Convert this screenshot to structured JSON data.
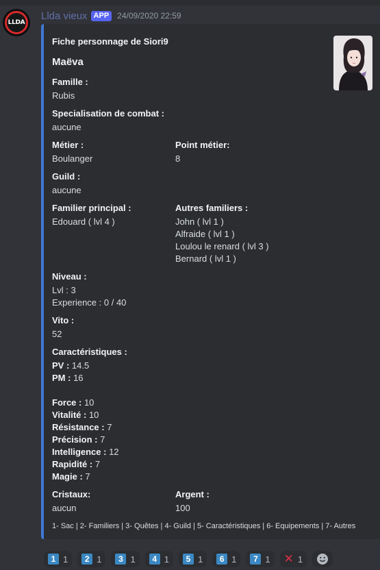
{
  "message": {
    "username": "Llda vieux",
    "badge": "APP",
    "timestamp": "24/09/2020 22:59",
    "avatar_text": "LLDA"
  },
  "embed": {
    "accent_color": "#3f79d6",
    "author": "Fiche personnage de Siori9",
    "title": "Maëva",
    "fields": {
      "famille_label": "Famille :",
      "famille_value": "Rubis",
      "specialisation_label": "Specialisation de combat :",
      "specialisation_value": "aucune",
      "metier_label": "Métier :",
      "metier_value": "Boulanger",
      "point_metier_label": "Point métier:",
      "point_metier_value": "8",
      "guild_label": "Guild :",
      "guild_value": "aucune",
      "familier_principal_label": "Familier principal :",
      "familier_principal_value": "Edouard ( lvl 4 )",
      "autres_familiers_label": "Autres familiers :",
      "autres_familiers": [
        "John ( lvl 1 )",
        "Alfraide ( lvl 1 )",
        "Loulou le renard ( lvl 3 )",
        "Bernard ( lvl 1 )"
      ],
      "niveau_label": "Niveau :",
      "niveau_lvl": "Lvl : 3",
      "niveau_xp": "Experience : 0 / 40",
      "vito_label": "Vito :",
      "vito_value": "52",
      "carac_label": "Caractéristiques :",
      "pv_label": "PV :",
      "pv_value": " 14.5",
      "pm_label": "PM :",
      "pm_value": " 16",
      "stats": [
        {
          "label": "Force :",
          "value": " 10"
        },
        {
          "label": "Vitalité :",
          "value": " 10"
        },
        {
          "label": "Résistance :",
          "value": " 7"
        },
        {
          "label": "Précision :",
          "value": " 7"
        },
        {
          "label": "Intelligence :",
          "value": " 12"
        },
        {
          "label": "Rapidité :",
          "value": " 7"
        },
        {
          "label": "Magie :",
          "value": " 7"
        }
      ],
      "cristaux_label": "Cristaux:",
      "cristaux_value": "aucun",
      "argent_label": "Argent :",
      "argent_value": "100"
    },
    "footer": "1- Sac | 2- Familiers | 3- Quêtes | 4- Guild | 5- Caractéristiques | 6- Equipements | 7- Autres"
  },
  "reactions": [
    {
      "icon": "keycap-1-icon",
      "emoji": "1",
      "count": "1"
    },
    {
      "icon": "keycap-2-icon",
      "emoji": "2",
      "count": "1"
    },
    {
      "icon": "keycap-3-icon",
      "emoji": "3",
      "count": "1"
    },
    {
      "icon": "keycap-4-icon",
      "emoji": "4",
      "count": "1"
    },
    {
      "icon": "keycap-5-icon",
      "emoji": "5",
      "count": "1"
    },
    {
      "icon": "keycap-6-icon",
      "emoji": "6",
      "count": "1"
    },
    {
      "icon": "keycap-7-icon",
      "emoji": "7",
      "count": "1"
    },
    {
      "icon": "cross-mark-icon",
      "emoji": "✕",
      "count": "1"
    }
  ]
}
